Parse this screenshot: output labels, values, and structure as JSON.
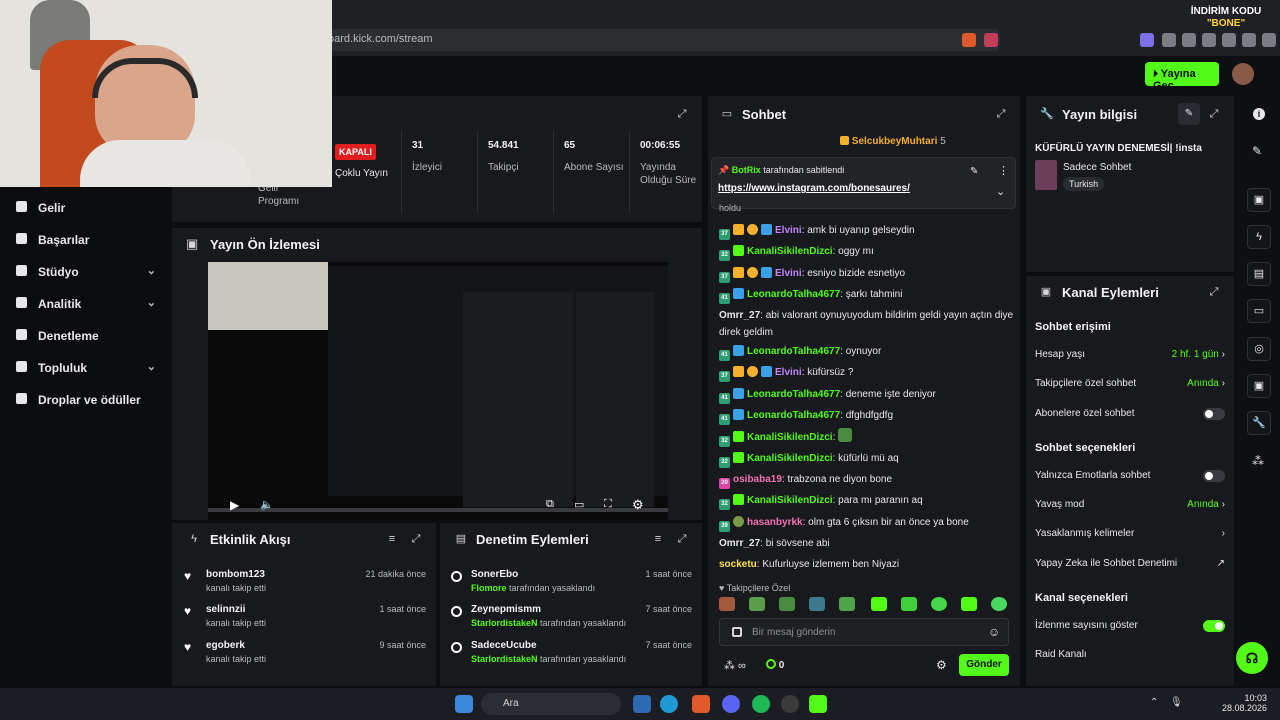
{
  "browser": {
    "url": "oard.kick.com/stream"
  },
  "promo": {
    "line1": "İNDİRİM KODU",
    "line2": "\"BONE\""
  },
  "header": {
    "go_live": "Yayına Geç"
  },
  "sidebar": {
    "items": [
      {
        "label": "Gelir",
        "chevron": false
      },
      {
        "label": "Başarılar",
        "chevron": false
      },
      {
        "label": "Stüdyo",
        "chevron": true
      },
      {
        "label": "Analitik",
        "chevron": true
      },
      {
        "label": "Denetleme",
        "chevron": false
      },
      {
        "label": "Topluluk",
        "chevron": true
      },
      {
        "label": "Droplar ve ödüller",
        "chevron": false
      }
    ]
  },
  "stats": {
    "status_badge": "KAPALI",
    "status_label": "Çoklu Yayın",
    "program_label": "Gelir Programı",
    "viewers": {
      "value": "31",
      "label": "İzleyici"
    },
    "followers": {
      "value": "54.841",
      "label": "Takipçi"
    },
    "subs": {
      "value": "65",
      "label": "Abone Sayısı"
    },
    "uptime": {
      "value": "00:06:55",
      "label": "Yayında Olduğu Süre"
    }
  },
  "preview": {
    "title": "Yayın Ön İzlemesi"
  },
  "activity": {
    "title": "Etkinlik Akışı",
    "items": [
      {
        "name": "bombom123",
        "sub": "kanalı takip etti",
        "time": "21 dakika önce"
      },
      {
        "name": "selinnzii",
        "sub": "kanalı takip etti",
        "time": "1 saat önce"
      },
      {
        "name": "egoberk",
        "sub": "kanalı takip etti",
        "time": "9 saat önce"
      }
    ]
  },
  "moderation": {
    "title": "Denetim Eylemleri",
    "items": [
      {
        "name": "SonerEbo",
        "by": "Flomore",
        "sub": "tarafından yasaklandı",
        "time": "1 saat önce"
      },
      {
        "name": "Zeynepmismm",
        "by": "StarlordistakeN",
        "sub": "tarafından yasaklandı",
        "time": "7 saat önce"
      },
      {
        "name": "SadeceUcube",
        "by": "StarlordistakeN",
        "sub": "tarafından yasaklandı",
        "time": "7 saat önce"
      }
    ]
  },
  "chat": {
    "title": "Sohbet",
    "top_gifter": "SelcukbeyMuhtari",
    "top_gifter_count": "5",
    "pinned_by": "BotRix",
    "pinned_by_suffix": "tarafından sabitlendi",
    "pinned_link": "https://www.instagram.com/bonesaures/",
    "partial": "holdu",
    "messages": [
      {
        "user": "Elvini",
        "color": "#c084fc",
        "text": "amk bi uyanıp gelseydin",
        "badges": [
          "37",
          "crown",
          "coin",
          "mod"
        ]
      },
      {
        "user": "KanaliSikilenDizci",
        "color": "#53fc18",
        "text": "oggy mı",
        "badges": [
          "32",
          "gift"
        ]
      },
      {
        "user": "Elvini",
        "color": "#c084fc",
        "text": "esniyo bizide esnetiyo",
        "badges": [
          "37",
          "crown",
          "coin",
          "mod"
        ]
      },
      {
        "user": "LeonardoTalha4677",
        "color": "#53fc18",
        "text": "şarkı tahmini",
        "badges": [
          "41",
          "mod"
        ]
      },
      {
        "user": "Omrr_27",
        "color": "#e8e8ea",
        "text": "abi valorant oynuyuyodum bildirim geldi yayın açtın diye direk geldim",
        "badges": []
      },
      {
        "user": "LeonardoTalha4677",
        "color": "#53fc18",
        "text": "oynuyor",
        "badges": [
          "41",
          "mod"
        ]
      },
      {
        "user": "Elvini",
        "color": "#c084fc",
        "text": "küfürsüz ?",
        "badges": [
          "37",
          "crown",
          "coin",
          "mod"
        ]
      },
      {
        "user": "LeonardoTalha4677",
        "color": "#53fc18",
        "text": "deneme işte deniyor",
        "badges": [
          "41",
          "mod"
        ]
      },
      {
        "user": "LeonardoTalha4677",
        "color": "#53fc18",
        "text": "dfghdfgdfg",
        "badges": [
          "41",
          "mod"
        ]
      },
      {
        "user": "KanaliSikilenDizci",
        "color": "#53fc18",
        "text": "",
        "badges": [
          "32",
          "gift"
        ]
      },
      {
        "user": "KanaliSikilenDizci",
        "color": "#53fc18",
        "text": "küfürlü mü aq",
        "badges": [
          "32",
          "gift"
        ]
      },
      {
        "user": "osibaba19",
        "color": "#f472b6",
        "text": "trabzona ne diyon bone",
        "badges": [
          "20"
        ]
      },
      {
        "user": "KanaliSikilenDizci",
        "color": "#53fc18",
        "text": "para mı paranın aq",
        "badges": [
          "32",
          "gift"
        ]
      },
      {
        "user": "hasanbyrkk",
        "color": "#f472b6",
        "text": "olm gta 6 çıksın bir an önce ya bone",
        "badges": [
          "39",
          "avatar"
        ]
      },
      {
        "user": "Omrr_27",
        "color": "#e8e8ea",
        "text": "bi sövsene abi",
        "badges": []
      },
      {
        "user": "socketu",
        "color": "#fde047",
        "text": "Kufurluyse izlemem ben Niyazi",
        "badges": []
      }
    ],
    "followers_only": "Takipçilere Özel",
    "input_placeholder": "Bir mesaj gönderin",
    "points": "0",
    "send": "Gönder"
  },
  "info": {
    "title": "Yayın bilgisi",
    "stream_title": "KÜFÜRLÜ YAYIN DENEMESİ| !insta",
    "category": "Sadece Sohbet",
    "language": "Turkish"
  },
  "actions": {
    "title": "Kanal Eylemleri",
    "sections": {
      "access": "Sohbet erişimi",
      "options": "Sohbet seçenekleri",
      "channel": "Kanal seçenekleri"
    },
    "rows": {
      "account_age": {
        "label": "Hesap yaşı",
        "value": "2 hf. 1 gün"
      },
      "followers_chat": {
        "label": "Takipçilere özel sohbet",
        "value": "Anında"
      },
      "subs_chat": {
        "label": "Abonelere özel sohbet"
      },
      "emotes_only": {
        "label": "Yalnızca Emotlarla sohbet"
      },
      "slow_mode": {
        "label": "Yavaş mod",
        "value": "Anında"
      },
      "banned_words": {
        "label": "Yasaklanmış kelimeler"
      },
      "ai_mod": {
        "label": "Yapay Zeka ile Sohbet Denetimi"
      },
      "show_viewers": {
        "label": "İzlenme sayısını göster"
      },
      "raid": {
        "label": "Raid Kanalı"
      }
    }
  },
  "taskbar": {
    "search": "Ara",
    "time": "10:03",
    "date": "28.08.2026"
  },
  "colors": {
    "accent": "#53fc18",
    "panel": "#18191c",
    "bg": "#0b0c0e"
  }
}
